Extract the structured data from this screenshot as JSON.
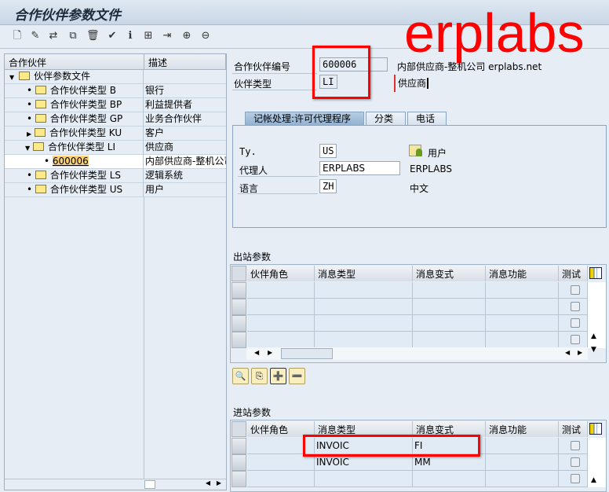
{
  "title": "合作伙伴参数文件",
  "watermark": "erplabs",
  "toolbar": {
    "icons": [
      "new-icon",
      "edit-icon",
      "change-icon",
      "copy-icon",
      "delete-icon",
      "check-icon",
      "info-icon",
      "hierarchy-icon",
      "transfer-icon",
      "expand-icon",
      "collapse-icon"
    ]
  },
  "tree": {
    "col1": "合作伙伴",
    "col2": "描述",
    "root": "伙伴参数文件",
    "items": [
      {
        "label": "合作伙伴类型 B",
        "desc": "银行"
      },
      {
        "label": "合作伙伴类型 BP",
        "desc": "利益提供者"
      },
      {
        "label": "合作伙伴类型 GP",
        "desc": "业务合作伙伴"
      },
      {
        "label": "合作伙伴类型 KU",
        "desc": "客户"
      },
      {
        "label": "合作伙伴类型 LI",
        "desc": "供应商"
      },
      {
        "label": "600006",
        "desc": "内部供应商-整机公司"
      },
      {
        "label": "合作伙伴类型 LS",
        "desc": "逻辑系统"
      },
      {
        "label": "合作伙伴类型 US",
        "desc": "用户"
      }
    ]
  },
  "header": {
    "partner_no_label": "合作伙伴编号",
    "partner_no": "600006",
    "partner_desc": "内部供应商-整机公司 erplabs.net",
    "partner_type_label": "伙伴类型",
    "partner_type": "LI",
    "partner_type_desc": "供应商"
  },
  "tabs": [
    "记帐处理:许可代理程序",
    "分类",
    "电话"
  ],
  "tabpanel": {
    "ty_label": "Ty.",
    "ty": "US",
    "ty_desc": "用户",
    "agent_label": "代理人",
    "agent": "ERPLABS",
    "agent_desc": "ERPLABS",
    "lang_label": "语言",
    "lang": "ZH",
    "lang_desc": "中文"
  },
  "outbound": {
    "title": "出站参数",
    "columns": [
      "伙伴角色",
      "消息类型",
      "消息变式",
      "消息功能",
      "测试"
    ],
    "rows": [
      [
        "",
        "",
        "",
        "",
        ""
      ],
      [
        "",
        "",
        "",
        "",
        ""
      ],
      [
        "",
        "",
        "",
        "",
        ""
      ],
      [
        "",
        "",
        "",
        "",
        ""
      ]
    ]
  },
  "inbound": {
    "title": "进站参数",
    "columns": [
      "伙伴角色",
      "消息类型",
      "消息变式",
      "消息功能",
      "测试"
    ],
    "rows": [
      [
        "",
        "INVOIC",
        "FI",
        "",
        ""
      ],
      [
        "",
        "INVOIC",
        "MM",
        "",
        ""
      ],
      [
        "",
        "",
        "",
        "",
        ""
      ]
    ]
  },
  "grid_buttons": [
    "details-icon",
    "copy-rows-icon",
    "insert-row-icon",
    "delete-row-icon"
  ]
}
